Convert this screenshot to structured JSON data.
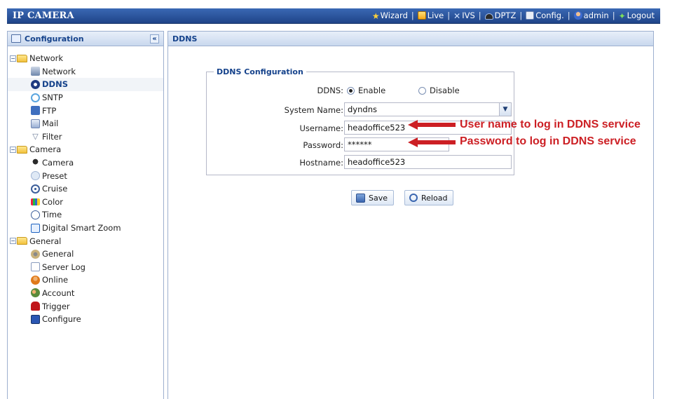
{
  "app": {
    "title": "IP CAMERA"
  },
  "topnav": {
    "items": [
      {
        "label": "Wizard",
        "icon": "wizard-icon"
      },
      {
        "label": "Live",
        "icon": "live-icon"
      },
      {
        "label": "IVS",
        "icon": "ivs-icon"
      },
      {
        "label": "DPTZ",
        "icon": "dptz-icon"
      },
      {
        "label": "Config.",
        "icon": "config-icon"
      },
      {
        "label": "admin",
        "icon": "admin-icon"
      },
      {
        "label": "Logout",
        "icon": "logout-icon"
      }
    ],
    "separator": "|"
  },
  "sidebar": {
    "title": "Configuration",
    "collapse_symbol": "«",
    "groups": [
      {
        "label": "Network",
        "expander": "−",
        "items": [
          {
            "label": "Network",
            "icon": "network-icon"
          },
          {
            "label": "DDNS",
            "icon": "ddns-icon",
            "active": true
          },
          {
            "label": "SNTP",
            "icon": "sntp-icon"
          },
          {
            "label": "FTP",
            "icon": "ftp-icon"
          },
          {
            "label": "Mail",
            "icon": "mail-icon"
          },
          {
            "label": "Filter",
            "icon": "filter-icon"
          }
        ]
      },
      {
        "label": "Camera",
        "expander": "−",
        "items": [
          {
            "label": "Camera",
            "icon": "camera-icon"
          },
          {
            "label": "Preset",
            "icon": "preset-icon"
          },
          {
            "label": "Cruise",
            "icon": "cruise-icon"
          },
          {
            "label": "Color",
            "icon": "color-icon"
          },
          {
            "label": "Time",
            "icon": "time-icon"
          },
          {
            "label": "Digital Smart Zoom",
            "icon": "zoom-icon"
          }
        ]
      },
      {
        "label": "General",
        "expander": "−",
        "items": [
          {
            "label": "General",
            "icon": "general-icon"
          },
          {
            "label": "Server Log",
            "icon": "server-log-icon"
          },
          {
            "label": "Online",
            "icon": "online-icon"
          },
          {
            "label": "Account",
            "icon": "account-icon"
          },
          {
            "label": "Trigger",
            "icon": "trigger-icon"
          },
          {
            "label": "Configure",
            "icon": "configure-icon"
          }
        ]
      }
    ]
  },
  "main": {
    "panel_title": "DDNS",
    "section_title": "DDNS Configuration",
    "form": {
      "ddns_label": "DDNS:",
      "enable_label": "Enable",
      "disable_label": "Disable",
      "ddns_selected": "Enable",
      "system_name_label": "System Name:",
      "system_name_value": "dyndns",
      "username_label": "Username:",
      "username_value": "headoffice523",
      "password_label": "Password:",
      "password_value": "******",
      "hostname_label": "Hostname:",
      "hostname_value": "headoffice523"
    },
    "buttons": {
      "save": "Save",
      "reload": "Reload"
    }
  },
  "annotations": {
    "username_note": "User name to log in DDNS service",
    "password_note": "Password to log in DDNS service",
    "color": "#cc1f24"
  },
  "colors": {
    "topbar": "#2a559e",
    "panel_header": "#15428b",
    "border": "#9db0cf"
  }
}
